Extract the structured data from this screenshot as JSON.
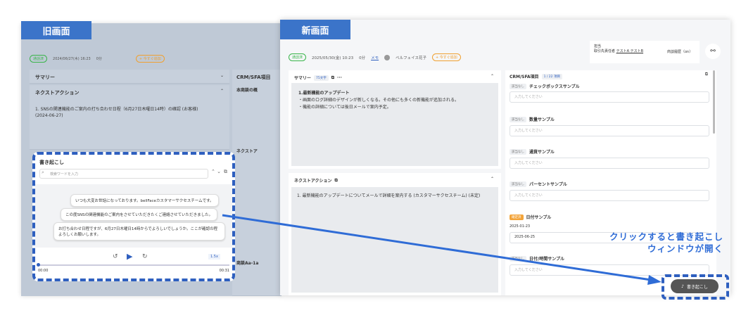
{
  "labels": {
    "old": "旧画面",
    "new": "新画面"
  },
  "old": {
    "badge": "通話済",
    "date": "2024/06/27(木) 16:23",
    "dur": "0分",
    "tag": "+ 今すぐ追加",
    "summary": "サマリー",
    "next_action": "ネクストアクション",
    "next_text": "1. SNSの関連機能のご案内の打ち合わせ日程（6月27日木曜日14時）の確認 (お客様)",
    "next_date": "(2024-06-27)",
    "crm": "CRM/SFA項目",
    "crm_item1": "本商談の概",
    "crm_item2": "ネクストア",
    "crm_item3": "商談Aa-1a",
    "transcription": "書き起こし",
    "search_placeholder": "検索ワードを入力",
    "bubbles": [
      "いつも大変お世話になっております。bellFaceカスタマーサクセスチームです。",
      "この度SNSの関連機能のご案内をさせていただきたくご連絡させていただきました。",
      "お打ち合わせ日程ですが、6月27日木曜日14時からでよろしいでしょうか。ここが確認の程よろしくお願いします。"
    ],
    "speed": "1.5x",
    "t_start": "00:00",
    "t_end": "00:31"
  },
  "new": {
    "badge": "通話済",
    "date": "2025/05/30(金) 10:23",
    "dur": "0分",
    "memo": "メモ",
    "user": "ベルフェイス花子",
    "tag": "+ 今すぐ追加",
    "owner_label": "担当",
    "owner_sub": "取引先責任者",
    "owner_name": "テストA テストB",
    "history": "商談履歴（on）",
    "summary": "サマリー",
    "summary_count": "75文字",
    "summary_title": "1.最新機能のアップデート",
    "summary_lines": [
      "・画面のログ詳細のデザインが新しくなる。その他にも多くの新機能が追加される。",
      "・機能の詳細については後日メールで案内予定。"
    ],
    "next": "ネクストアクション",
    "next_text": "1. 最新機能のアップデートについてメールで詳細を案内する (カスタマーサクセスチーム) (未定)",
    "crm": "CRM/SFA項目",
    "crm_count": "1 / 22 項目",
    "none": "該当なし",
    "placeholder": "入力してください",
    "fields": [
      "チェックボックスサンプル",
      "数量サンプル",
      "通貨サンプル",
      "パーセントサンプル"
    ],
    "done": "確定済",
    "date_field": "日付サンプル",
    "date_val1": "2025-01-23",
    "date_val2": "2025-06-25",
    "datetime_field": "日付/時間サンプル",
    "tx_button": "書き起こし"
  },
  "callout": [
    "クリックすると書き起こし",
    "ウィンドウが開く"
  ]
}
